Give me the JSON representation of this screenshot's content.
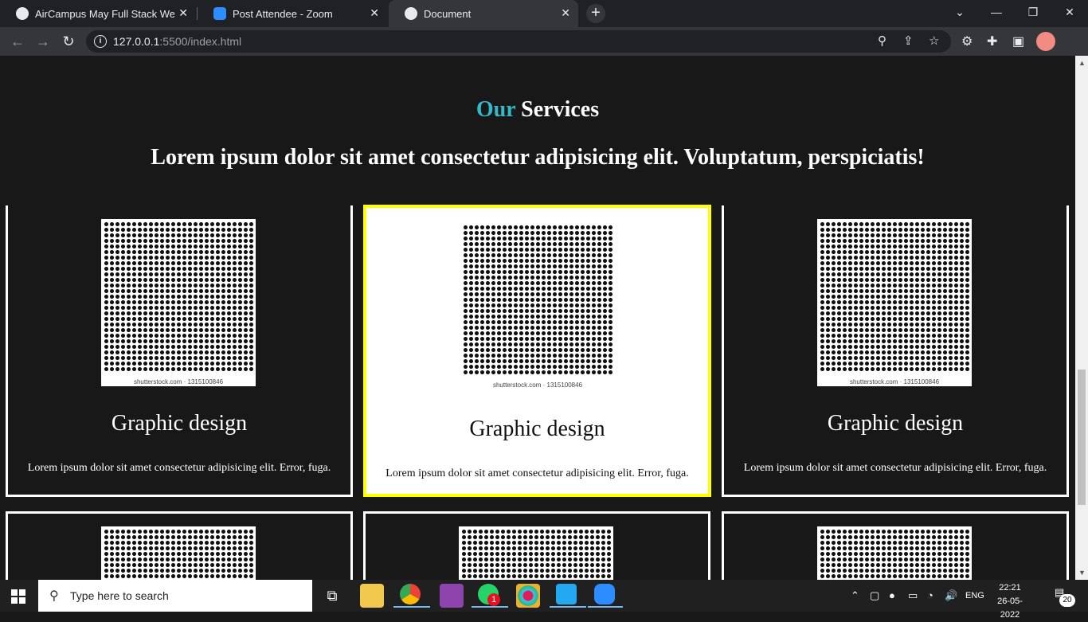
{
  "browser": {
    "tabs": [
      {
        "title": "AirCampus May Full Stack Web D",
        "icon": "globe-icon"
      },
      {
        "title": "Post Attendee - Zoom",
        "icon": "zoom-icon"
      },
      {
        "title": "Document",
        "icon": "globe-icon",
        "active": true
      }
    ],
    "url_host": "127.0.0.1",
    "url_path": ":5500/index.html"
  },
  "page": {
    "heading_accent": "Our",
    "heading_rest": " Services",
    "subheading": "Lorem ipsum dolor sit amet consectetur adipisicing elit. Voluptatum, perspiciatis!",
    "cards": [
      {
        "title": "Graphic design",
        "text": "Lorem ipsum dolor sit amet consectetur adipisicing elit. Error, fuga.",
        "watermark": "shutterstock.com · 1315100846"
      },
      {
        "title": "Graphic design",
        "text": "Lorem ipsum dolor sit amet consectetur adipisicing elit. Error, fuga.",
        "watermark": "shutterstock.com · 1315100846"
      },
      {
        "title": "Graphic design",
        "text": "Lorem ipsum dolor sit amet consectetur adipisicing elit. Error, fuga.",
        "watermark": "shutterstock.com · 1315100846"
      }
    ],
    "accent_color": "#35b8c8",
    "highlight_border_color": "#ffff00"
  },
  "taskbar": {
    "search_placeholder": "Type here to search",
    "whatsapp_badge": "1",
    "language": "ENG",
    "time": "22:21",
    "date": "26-05-2022",
    "notifications": "20"
  }
}
